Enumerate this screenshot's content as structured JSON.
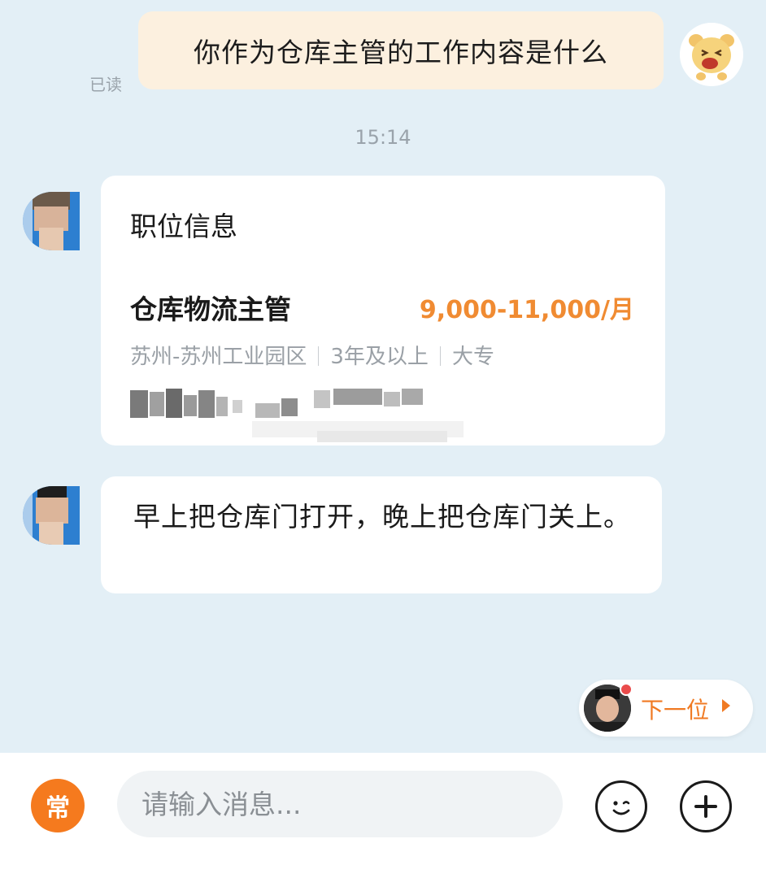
{
  "outgoing_message": {
    "text": "你作为仓库主管的工作内容是什么",
    "read_status": "已读"
  },
  "timestamp": "15:14",
  "job_card": {
    "title": "职位信息",
    "job_name": "仓库物流主管",
    "salary": "9,000-11,000/月",
    "location": "苏州-苏州工业园区",
    "experience": "3年及以上",
    "education": "大专"
  },
  "reply_message": {
    "text": "早上把仓库门打开，晚上把仓库门关上。"
  },
  "next_button": {
    "label": "下一位"
  },
  "input_bar": {
    "quick_phrase_label": "常",
    "placeholder": "请输入消息..."
  },
  "colors": {
    "background": "#e3eff6",
    "outgoing_bubble": "#fcf0df",
    "salary": "#f08b32",
    "accent": "#f57a1e"
  },
  "icons": {
    "emoji": "smiley-face-icon",
    "plus": "plus-circle-icon"
  }
}
